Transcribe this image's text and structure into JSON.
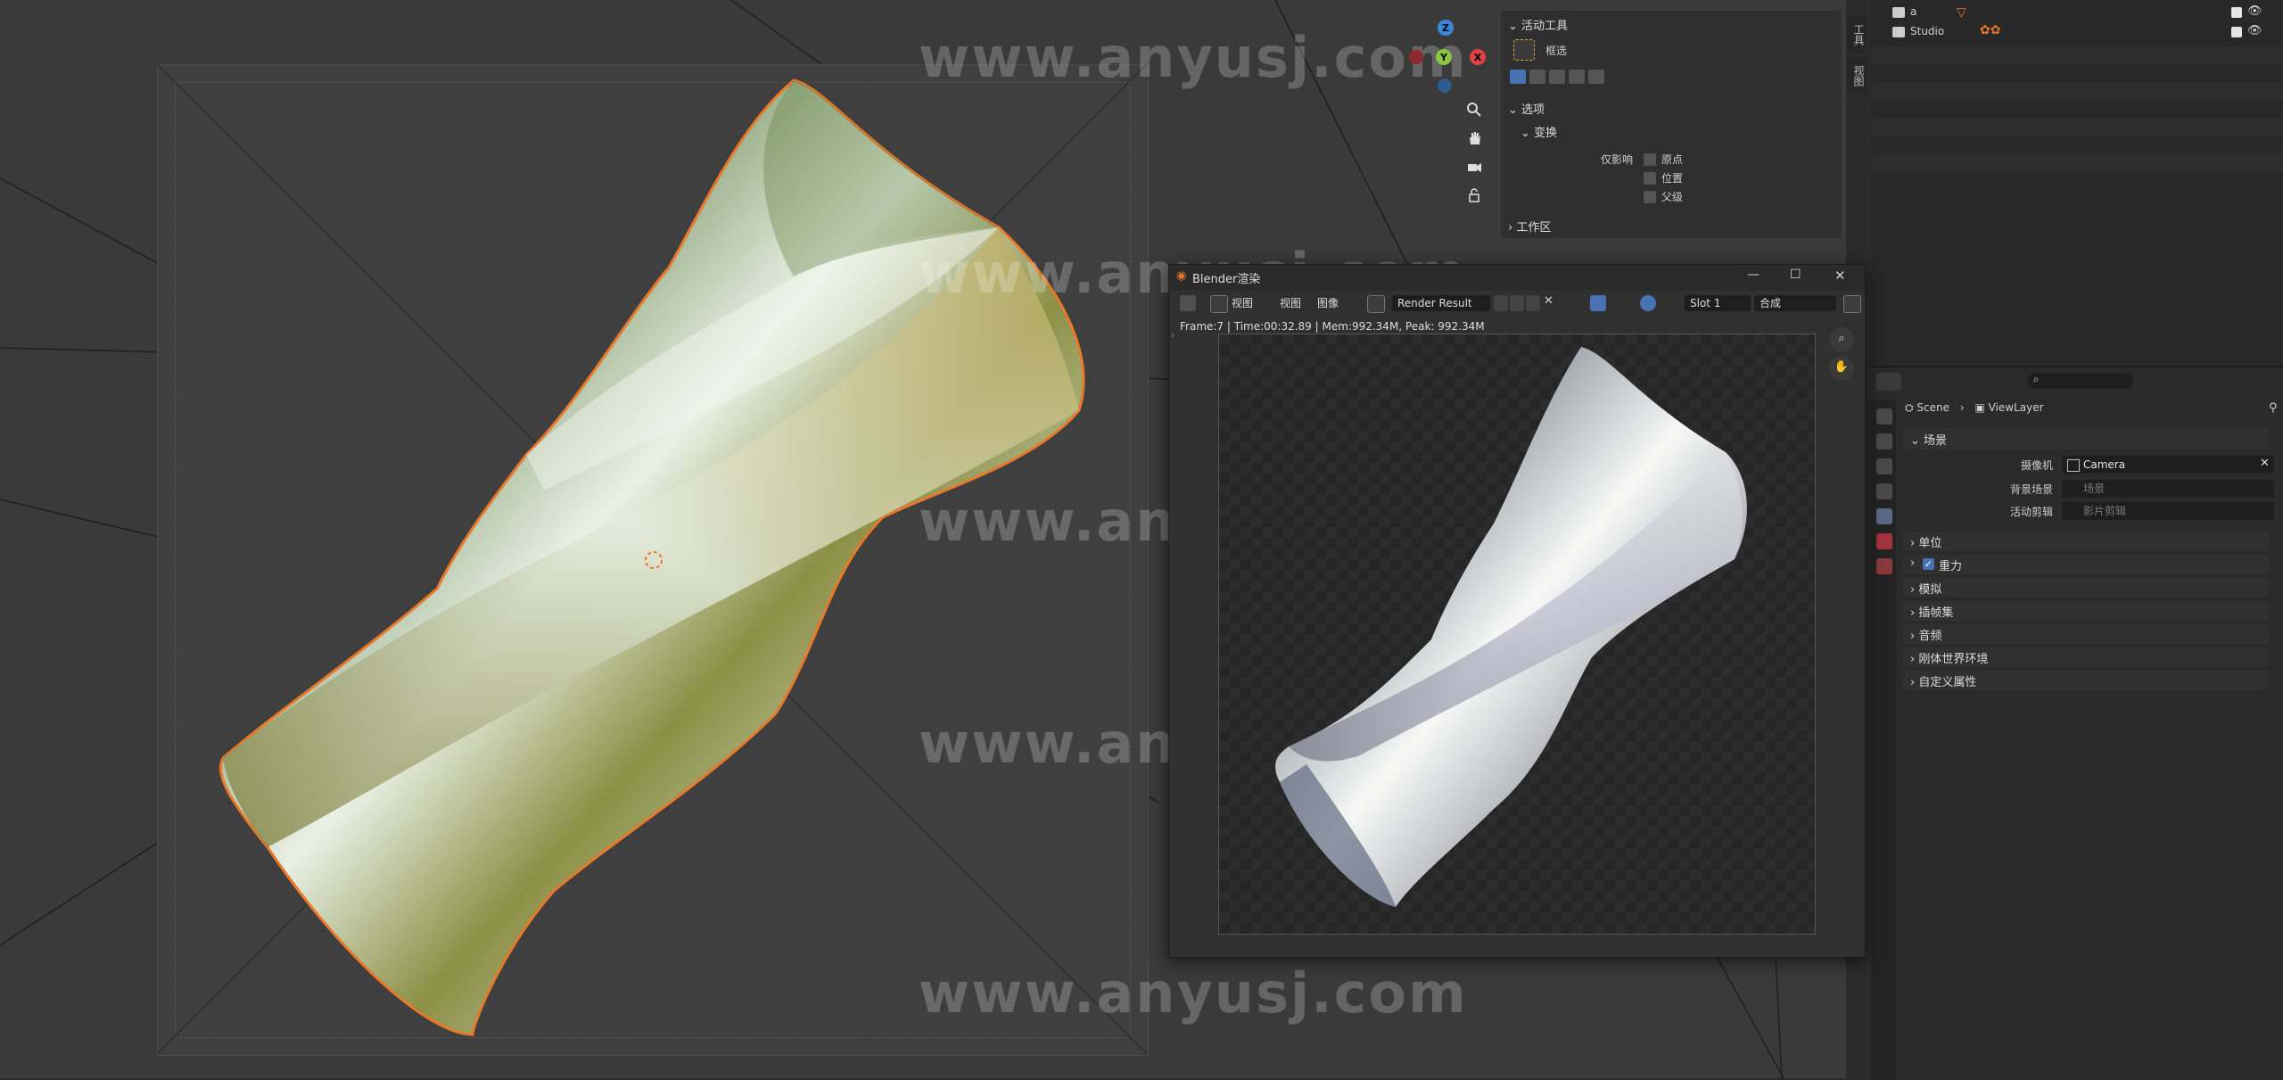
{
  "watermark": "www.anyusj.com",
  "viewport": {
    "gizmo": {
      "z": "Z",
      "y": "Y",
      "x": "X"
    },
    "colors": {
      "x_axis": "#e0424a",
      "y_axis": "#8bc53f",
      "z_axis": "#3a87d8",
      "selection_outline": "#e8782a"
    }
  },
  "npanel": {
    "active_tool_header": "活动工具",
    "tool_name": "框选",
    "options_header": "选项",
    "transform_header": "变换",
    "affect_only_label": "仅影响",
    "checkboxes": [
      "原点",
      "位置",
      "父级"
    ],
    "workspace_header": "工作区",
    "side_tabs": [
      "工具",
      "视图"
    ]
  },
  "outliner": {
    "rows": [
      {
        "label": "a",
        "checked": true
      },
      {
        "label": "Studio",
        "checked": true
      }
    ]
  },
  "render_window": {
    "title": "Blender渲染",
    "menu": [
      "视图",
      "视图",
      "图像"
    ],
    "image_name": "Render Result",
    "slot": "Slot 1",
    "layer": "合成",
    "info": "Frame:7 | Time:00:32.89 | Mem:992.34M, Peak: 992.34M"
  },
  "properties": {
    "search_placeholder": "",
    "breadcrumb": [
      "Scene",
      "ViewLayer"
    ],
    "scene_header": "场景",
    "fields": [
      {
        "label": "摄像机",
        "value": "Camera",
        "placeholder": false
      },
      {
        "label": "背景场景",
        "value": "场景",
        "placeholder": true
      },
      {
        "label": "活动剪辑",
        "value": "影片剪辑",
        "placeholder": true
      }
    ],
    "sections": [
      "单位",
      "重力",
      "模拟",
      "插帧集",
      "音频",
      "刚体世界环境",
      "自定义属性"
    ],
    "gravity_checked": true
  }
}
